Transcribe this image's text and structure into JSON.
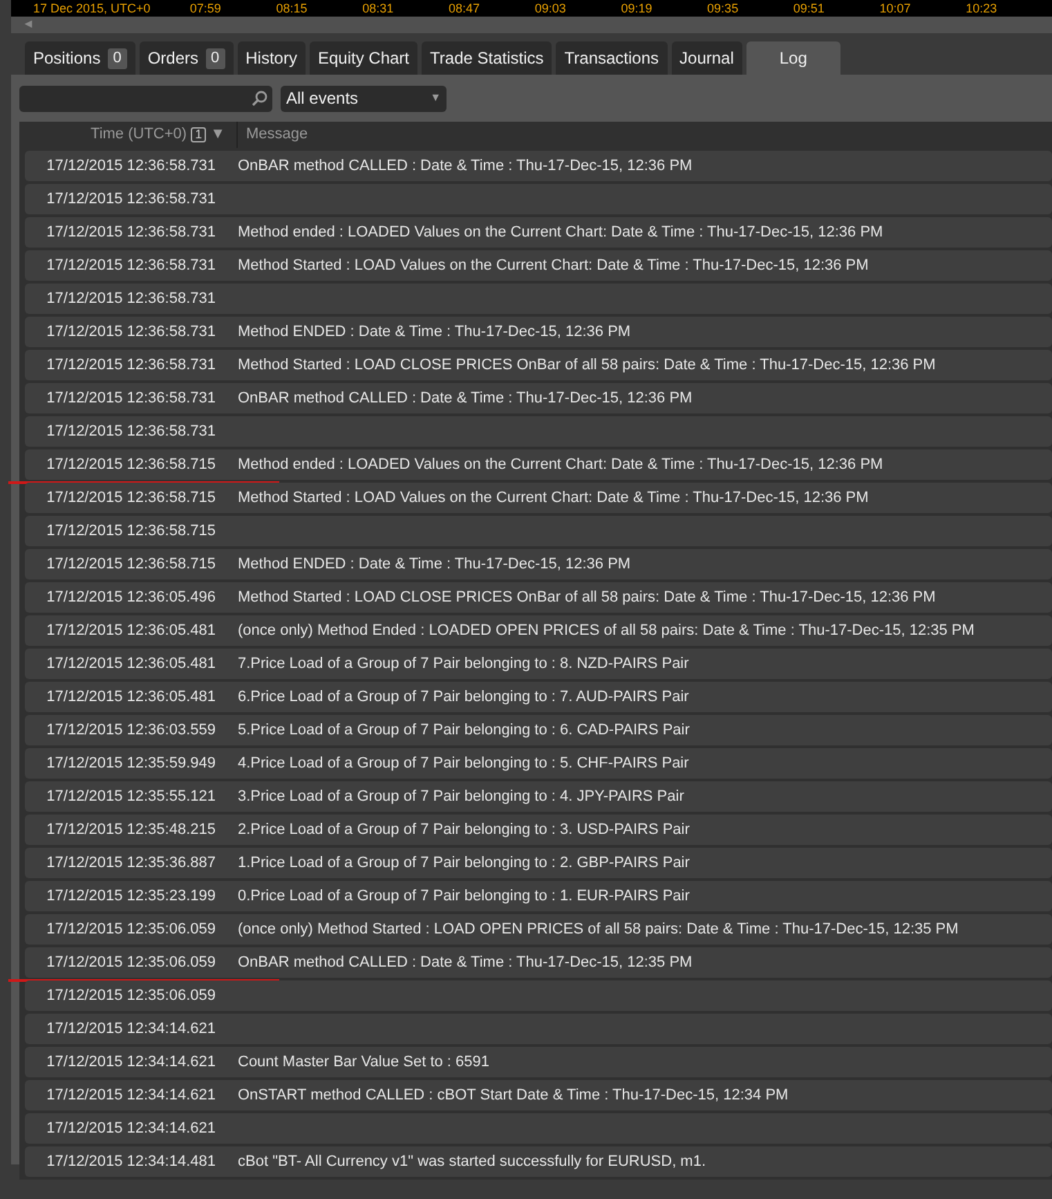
{
  "axis_labels": [
    "17 Dec 2015, UTC+0",
    "07:59",
    "08:15",
    "08:31",
    "08:47",
    "09:03",
    "09:19",
    "09:35",
    "09:51",
    "10:07",
    "10:23"
  ],
  "scroll_arrow": "◄",
  "tabs": [
    {
      "label": "Positions",
      "count": "0",
      "selected": false
    },
    {
      "label": "Orders",
      "count": "0",
      "selected": false
    },
    {
      "label": "History",
      "selected": false
    },
    {
      "label": "Equity Chart",
      "selected": false
    },
    {
      "label": "Trade Statistics",
      "selected": false
    },
    {
      "label": "Transactions",
      "selected": false
    },
    {
      "label": "Journal",
      "selected": false
    },
    {
      "label": "Log",
      "selected": true
    }
  ],
  "filter": {
    "events": "All events",
    "caret": "▼"
  },
  "columns": [
    {
      "label": "Time (UTC+0)",
      "sort_badge": "1",
      "sort_arrow": "▼"
    },
    {
      "label": "Message"
    }
  ],
  "rows": [
    {
      "time": "17/12/2015 12:36:58.731",
      "message": "OnBAR method CALLED :  Date & Time : Thu-17-Dec-15,  12:36 PM",
      "underlined": false
    },
    {
      "time": "17/12/2015 12:36:58.731",
      "message": "",
      "underlined": false
    },
    {
      "time": "17/12/2015 12:36:58.731",
      "message": "Method ended : LOADED Values on the Current Chart:  Date & Time : Thu-17-Dec-15,  12:36 PM",
      "underlined": false
    },
    {
      "time": "17/12/2015 12:36:58.731",
      "message": "Method Started : LOAD Values on the Current Chart:  Date & Time : Thu-17-Dec-15,  12:36 PM",
      "underlined": false
    },
    {
      "time": "17/12/2015 12:36:58.731",
      "message": "",
      "underlined": false
    },
    {
      "time": "17/12/2015 12:36:58.731",
      "message": "Method ENDED :  Date & Time : Thu-17-Dec-15,  12:36 PM",
      "underlined": false
    },
    {
      "time": "17/12/2015 12:36:58.731",
      "message": "Method Started : LOAD CLOSE PRICES OnBar of all 58 pairs:  Date & Time : Thu-17-Dec-15,  12:36 PM",
      "underlined": false
    },
    {
      "time": "17/12/2015 12:36:58.731",
      "message": "OnBAR method CALLED :  Date & Time : Thu-17-Dec-15,  12:36 PM",
      "underlined": false
    },
    {
      "time": "17/12/2015 12:36:58.731",
      "message": "",
      "underlined": false
    },
    {
      "time": "17/12/2015 12:36:58.715",
      "message": "Method ended : LOADED Values on the Current Chart:  Date & Time : Thu-17-Dec-15,  12:36 PM",
      "underlined": true
    },
    {
      "time": "17/12/2015 12:36:58.715",
      "message": "Method Started : LOAD Values on the Current Chart:  Date & Time : Thu-17-Dec-15,  12:36 PM",
      "underlined": false
    },
    {
      "time": "17/12/2015 12:36:58.715",
      "message": "",
      "underlined": false
    },
    {
      "time": "17/12/2015 12:36:58.715",
      "message": "Method ENDED :  Date & Time : Thu-17-Dec-15,  12:36 PM",
      "underlined": false
    },
    {
      "time": "17/12/2015 12:36:05.496",
      "message": "Method Started : LOAD CLOSE PRICES OnBar of all 58 pairs:  Date & Time : Thu-17-Dec-15,  12:36 PM",
      "underlined": false
    },
    {
      "time": "17/12/2015 12:36:05.481",
      "message": "(once only) Method Ended : LOADED OPEN PRICES of all 58 pairs:  Date & Time : Thu-17-Dec-15,  12:35 PM",
      "underlined": false
    },
    {
      "time": "17/12/2015 12:36:05.481",
      "message": "7.Price Load of a Group of 7 Pair belonging to : 8. NZD-PAIRS  Pair",
      "underlined": false
    },
    {
      "time": "17/12/2015 12:36:05.481",
      "message": "6.Price Load of a Group of 7 Pair belonging to : 7. AUD-PAIRS  Pair",
      "underlined": false
    },
    {
      "time": "17/12/2015 12:36:03.559",
      "message": "5.Price Load of a Group of 7 Pair belonging to : 6. CAD-PAIRS  Pair",
      "underlined": false
    },
    {
      "time": "17/12/2015 12:35:59.949",
      "message": "4.Price Load of a Group of 7 Pair belonging to : 5. CHF-PAIRS  Pair",
      "underlined": false
    },
    {
      "time": "17/12/2015 12:35:55.121",
      "message": "3.Price Load of a Group of 7 Pair belonging to : 4. JPY-PAIRS  Pair",
      "underlined": false
    },
    {
      "time": "17/12/2015 12:35:48.215",
      "message": "2.Price Load of a Group of 7 Pair belonging to : 3. USD-PAIRS  Pair",
      "underlined": false
    },
    {
      "time": "17/12/2015 12:35:36.887",
      "message": "1.Price Load of a Group of 7 Pair belonging to : 2. GBP-PAIRS  Pair",
      "underlined": false
    },
    {
      "time": "17/12/2015 12:35:23.199",
      "message": "0.Price Load of a Group of 7 Pair belonging to : 1. EUR-PAIRS  Pair",
      "underlined": false
    },
    {
      "time": "17/12/2015 12:35:06.059",
      "message": "(once only) Method Started : LOAD OPEN PRICES of all 58 pairs:  Date & Time : Thu-17-Dec-15,  12:35 PM",
      "underlined": false
    },
    {
      "time": "17/12/2015 12:35:06.059",
      "message": "OnBAR method CALLED :  Date & Time : Thu-17-Dec-15,  12:35 PM",
      "underlined": true
    },
    {
      "time": "17/12/2015 12:35:06.059",
      "message": "",
      "underlined": false
    },
    {
      "time": "17/12/2015 12:34:14.621",
      "message": "",
      "underlined": false
    },
    {
      "time": "17/12/2015 12:34:14.621",
      "message": "Count Master Bar Value Set to : 6591",
      "underlined": false
    },
    {
      "time": "17/12/2015 12:34:14.621",
      "message": "OnSTART method CALLED :  cBOT Start Date & Time : Thu-17-Dec-15,  12:34 PM",
      "underlined": false
    },
    {
      "time": "17/12/2015 12:34:14.621",
      "message": "",
      "underlined": false
    },
    {
      "time": "17/12/2015 12:34:14.481",
      "message": "cBot \"BT- All Currency v1\" was started successfully for EURUSD, m1.",
      "underlined": false
    }
  ]
}
